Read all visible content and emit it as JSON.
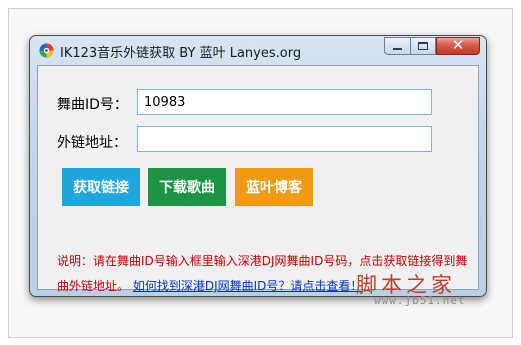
{
  "window": {
    "title": "IK123音乐外链获取 BY 蓝叶 Lanyes.org",
    "app_icon": "app-logo-icon",
    "controls": {
      "minimize_icon": "minimize-icon",
      "maximize_icon": "maximize-icon",
      "close_glyph": "✕"
    }
  },
  "form": {
    "id_label": "舞曲ID号：",
    "id_value": "10983",
    "link_label": "外链地址：",
    "link_value": ""
  },
  "buttons": {
    "get_link": {
      "label": "获取链接",
      "color": "#1fa6df"
    },
    "download": {
      "label": "下载歌曲",
      "color": "#1d9443"
    },
    "blog": {
      "label": "蓝叶博客",
      "color": "#f39a12"
    }
  },
  "note": {
    "text": "说明：请在舞曲ID号输入框里输入深港DJ网舞曲ID号码，点击获取链接得到舞曲外链地址。",
    "link_text": "如何找到深港DJ网舞曲ID号？请点击查看！"
  },
  "watermark": {
    "brand": "脚本之家",
    "url": "www.jb51.net"
  }
}
